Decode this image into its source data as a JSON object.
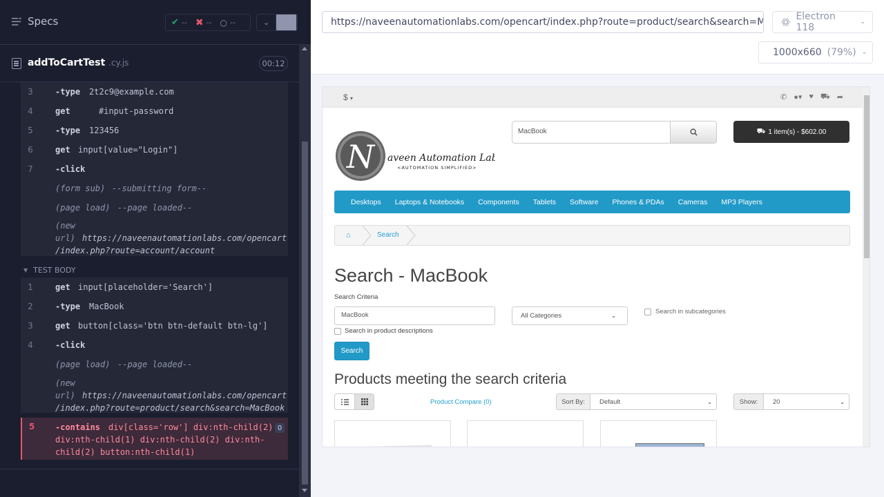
{
  "reporter": {
    "specs_label": "Specs",
    "stats": {
      "passed": "--",
      "failed": "--",
      "pending": "--"
    },
    "spec_name": "addToCartTest",
    "spec_ext": ".cy.js",
    "duration": "00:12"
  },
  "before_commands": [
    {
      "num": "3",
      "name": "-type",
      "message": "2t2c9@example.com"
    },
    {
      "num": "4",
      "name": "get",
      "message": "#input-password"
    },
    {
      "num": "5",
      "name": "-type",
      "message": "123456"
    },
    {
      "num": "6",
      "name": "get",
      "message": "input[value=\"Login\"]"
    },
    {
      "num": "7",
      "name": "-click",
      "message": ""
    }
  ],
  "before_events": [
    {
      "event": "(form sub)",
      "message": "--submitting form--"
    },
    {
      "event": "(page load)",
      "message": "--page loaded--"
    }
  ],
  "before_new_url": {
    "event_line1": "(new",
    "event_line2": "url)",
    "url_line1": "https://naveenautomationlabs.com/opencart",
    "url_line2": "/index.php?route=account/account"
  },
  "test_body_label": "TEST BODY",
  "body_commands": [
    {
      "num": "1",
      "name": "get",
      "message": "input[placeholder='Search']"
    },
    {
      "num": "2",
      "name": "-type",
      "message": "MacBook"
    },
    {
      "num": "3",
      "name": "get",
      "message": "button[class='btn btn-default btn-lg']"
    },
    {
      "num": "4",
      "name": "-click",
      "message": ""
    }
  ],
  "body_events": [
    {
      "event": "(page load)",
      "message": "--page loaded--"
    }
  ],
  "body_new_url": {
    "event_line1": "(new",
    "event_line2": "url)",
    "url_line1": "https://naveenautomationlabs.com/opencart",
    "url_line2": "/index.php?route=product/search&search=MacBook"
  },
  "failed_command": {
    "num": "5",
    "name": "-contains",
    "message_line1": "div[class='row'] div:nth-child(2)",
    "message_line2": "div:nth-child(1) div:nth-child(2) div:nth-",
    "message_line3": "child(2) button:nth-child(1)",
    "badge": "0"
  },
  "aut": {
    "url": "https://naveenautomationlabs.com/opencart/index.php?route=product/search&search=MacBook",
    "browser": "Electron 118",
    "viewport": "1000x660",
    "scale": "(79%)"
  },
  "site": {
    "currency": "$",
    "logo_text": "aveen Automation Labs",
    "logo_letter": "N",
    "logo_tagline": "<AUTOMATION SIMPLIFIED>",
    "search_value": "MacBook",
    "cart_label": "1 item(s) - $602.00",
    "menu": [
      "Desktops",
      "Laptops & Notebooks",
      "Components",
      "Tablets",
      "Software",
      "Phones & PDAs",
      "Cameras",
      "MP3 Players"
    ],
    "breadcrumb_search": "Search",
    "heading": "Search - MacBook",
    "criteria_label": "Search Criteria",
    "criteria_value": "MacBook",
    "category_selected": "All Categories",
    "subcategories_label": "Search in subcategories",
    "descriptions_label": "Search in product descriptions",
    "search_button": "Search",
    "products_heading": "Products meeting the search criteria",
    "compare_label": "Product Compare (0)",
    "sort_label": "Sort By:",
    "sort_selected": "Default",
    "show_label": "Show:",
    "show_selected": "20"
  },
  "colors": {
    "reporter_bg": "#1b1e2e",
    "command_bg": "#242837",
    "fail_red": "#e45770",
    "pass_green": "#1fa971",
    "opencart_blue": "#229ac8"
  }
}
